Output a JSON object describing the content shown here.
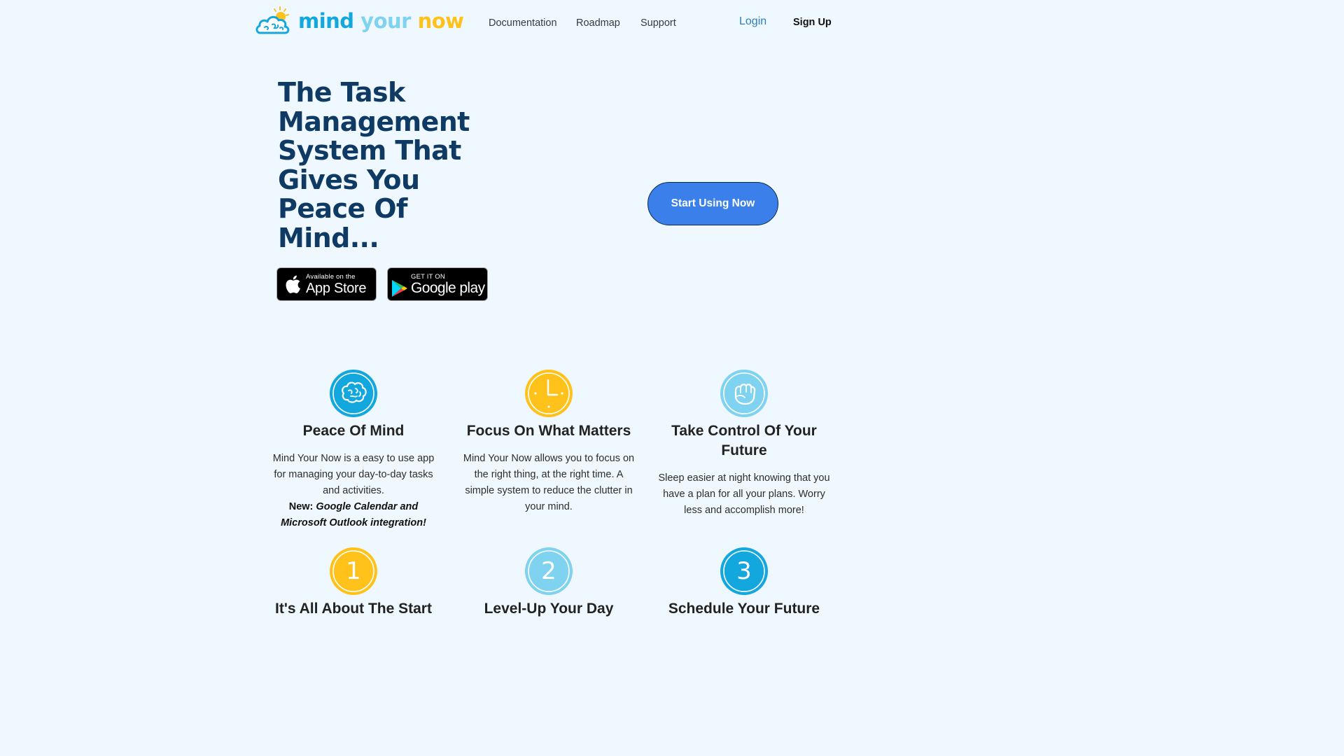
{
  "brand": {
    "word1": "mind",
    "word2": "your",
    "word3": "now",
    "colors": {
      "mind": "#12a7dd",
      "your": "#7fd3f0",
      "now": "#ffc21a"
    }
  },
  "nav": {
    "documentation": "Documentation",
    "roadmap": "Roadmap",
    "support": "Support",
    "login": "Login",
    "signup": "Sign Up"
  },
  "hero": {
    "title": "The Task Management System That Gives You Peace Of Mind...",
    "cta": "Start Using Now",
    "cta_color": "#3b80ea",
    "app_store": {
      "small": "Available on the",
      "large": "App Store"
    },
    "google_play": {
      "small": "GET IT ON",
      "large": "Google play"
    }
  },
  "features": [
    {
      "icon": "brain-icon",
      "title": "Peace Of Mind",
      "desc": "Mind Your Now is a easy to use app for managing your day-to-day tasks and activities.",
      "note_prefix": "New:",
      "note_text": "Google Calendar and Microsoft Outlook integration!"
    },
    {
      "icon": "clock-icon",
      "title": "Focus On What Matters",
      "desc": "Mind Your Now allows you to focus on the right thing, at the right time. A simple system to reduce the clutter in your mind."
    },
    {
      "icon": "fist-icon",
      "title": "Take Control Of Your Future",
      "desc": "Sleep easier at night knowing that you have a plan for all your plans. Worry less and accomplish more!"
    }
  ],
  "steps": [
    {
      "number": "1",
      "title": "It's All About The Start",
      "color": "#ffc21a"
    },
    {
      "number": "2",
      "title": "Level-Up Your Day",
      "color": "#7fd3f0"
    },
    {
      "number": "3",
      "title": "Schedule Your Future",
      "color": "#12a7dd"
    }
  ]
}
